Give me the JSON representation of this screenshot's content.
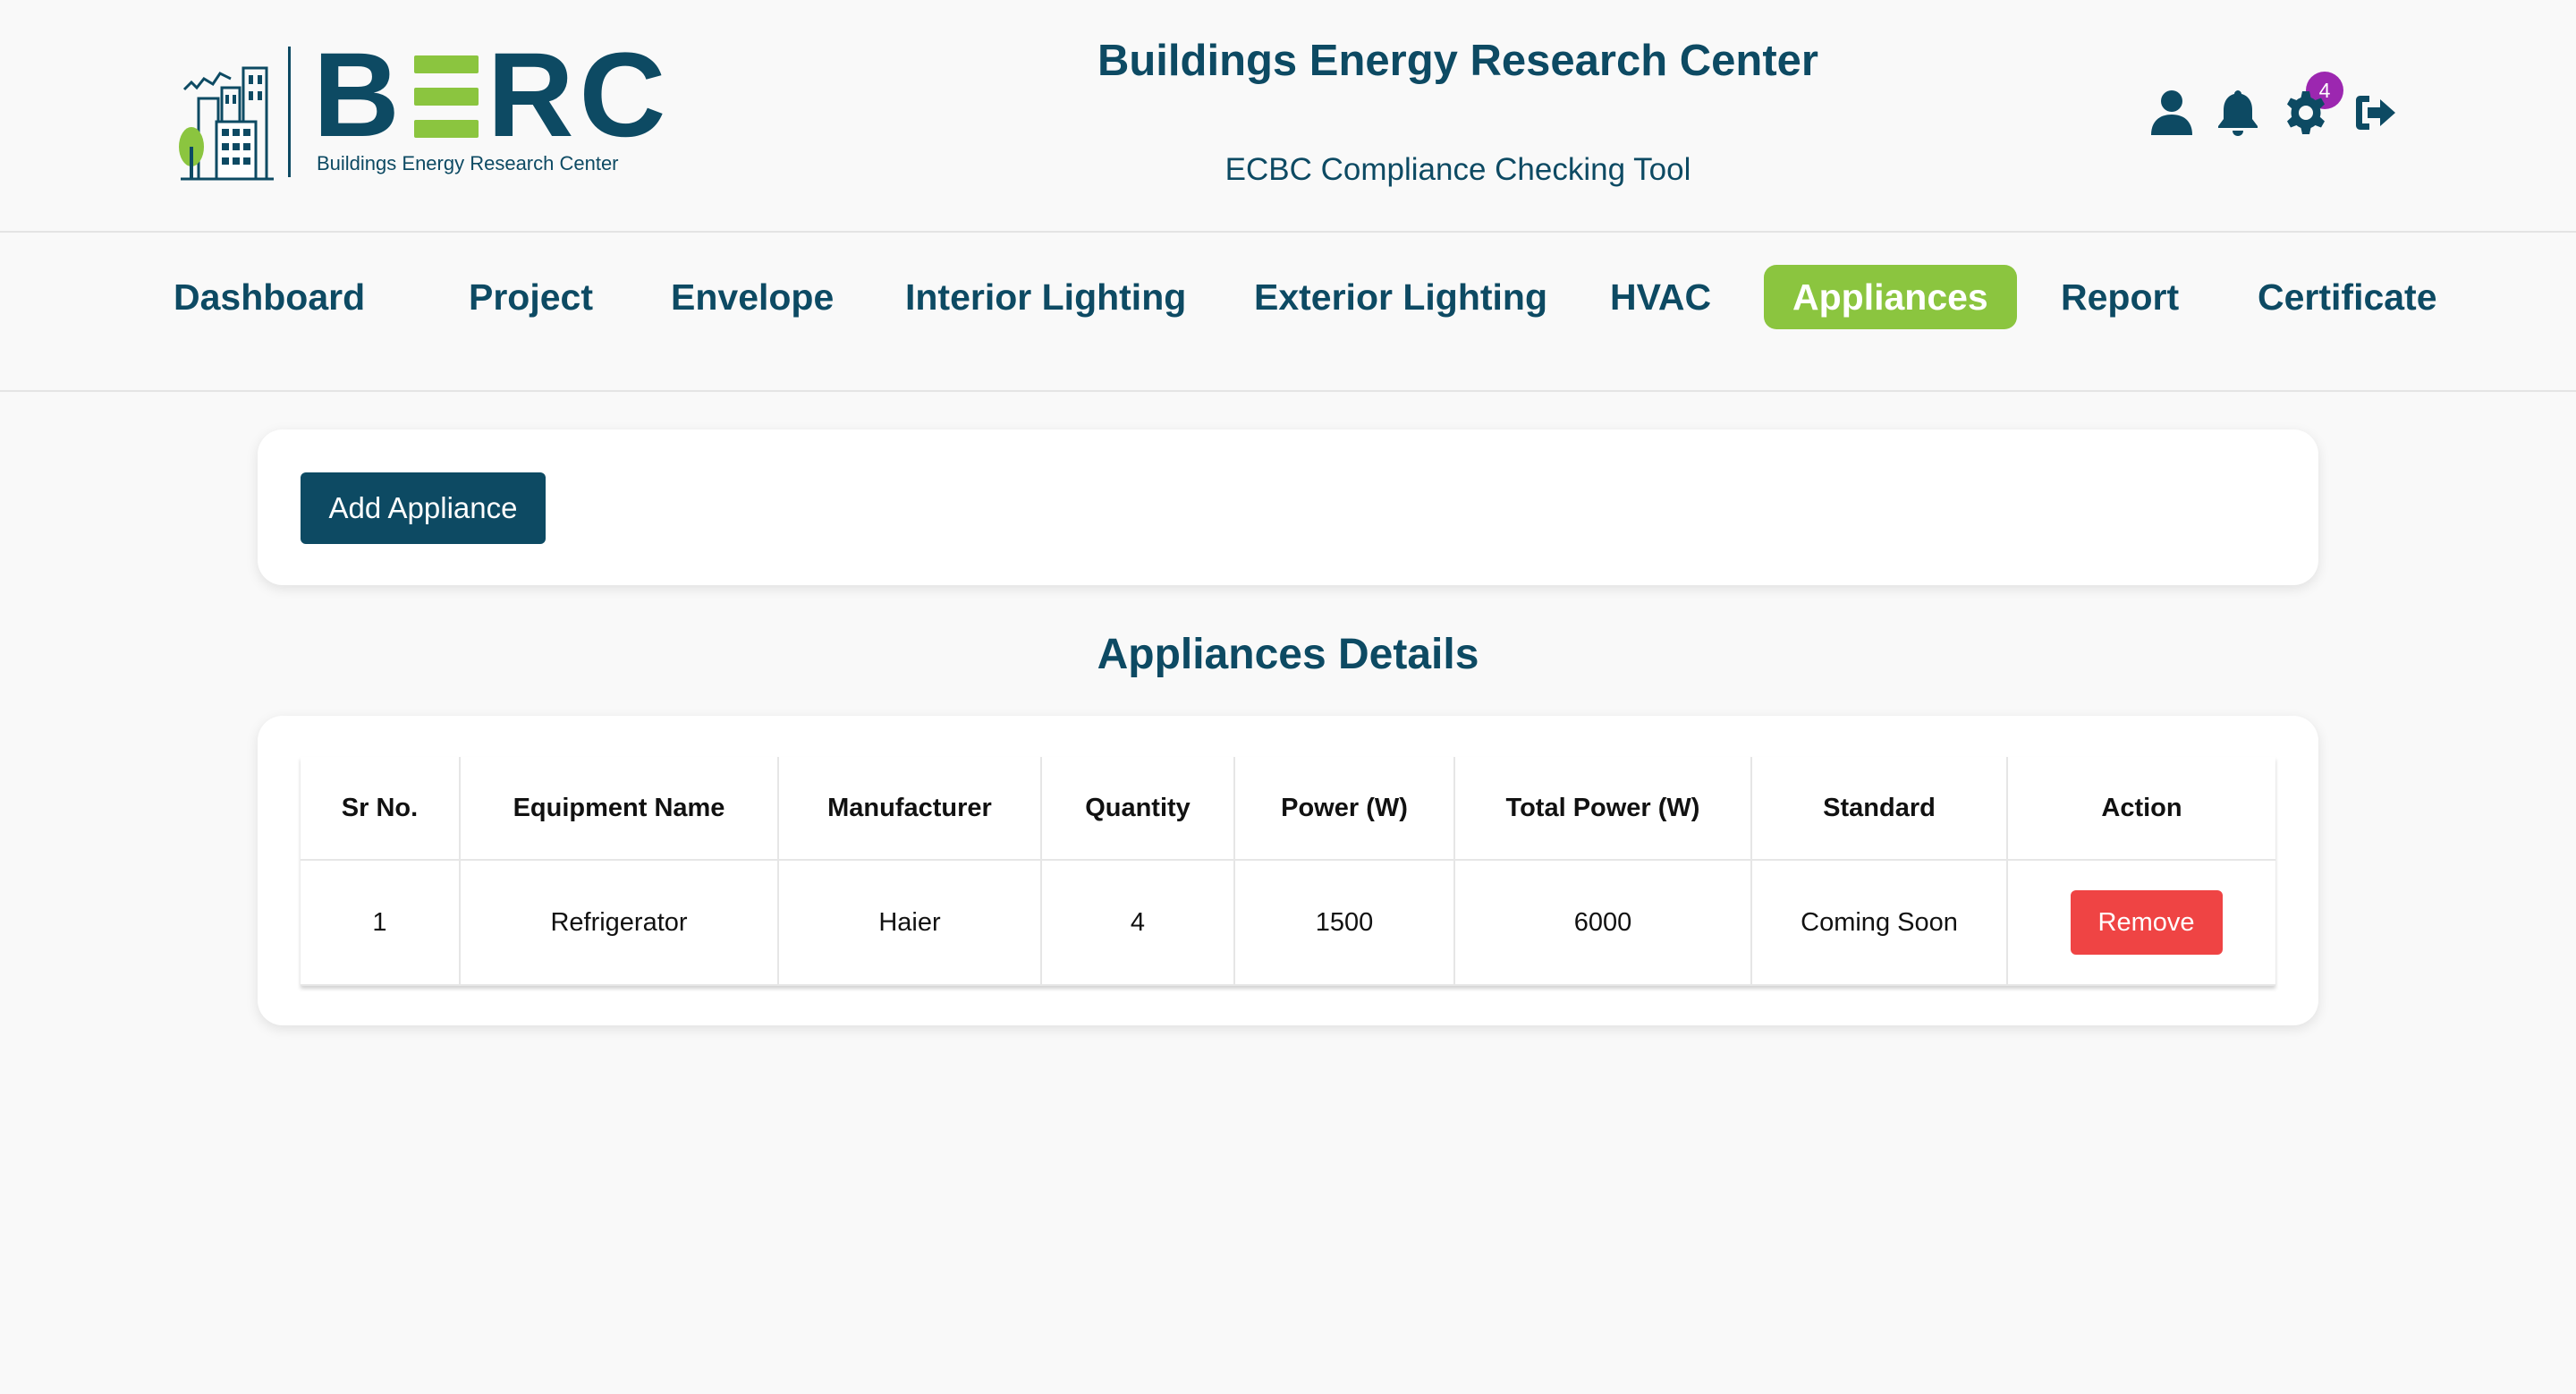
{
  "header": {
    "logo_word_left": "B",
    "logo_word_right": "RC",
    "logo_subtitle": "Buildings Energy Research Center",
    "title": "Buildings Energy Research Center",
    "subtitle": "ECBC Compliance Checking Tool",
    "icons": [
      "user-icon",
      "bell-icon",
      "gear-icon",
      "logout-icon"
    ],
    "notification_count": "4"
  },
  "nav": {
    "items": [
      {
        "label": "Dashboard"
      },
      {
        "label": "Project"
      },
      {
        "label": "Envelope"
      },
      {
        "label": "Interior Lighting"
      },
      {
        "label": "Exterior Lighting"
      },
      {
        "label": "HVAC"
      },
      {
        "label": "Appliances",
        "active": true
      },
      {
        "label": "Report"
      },
      {
        "label": "Certificate"
      }
    ]
  },
  "actions": {
    "add_label": "Add Appliance"
  },
  "section": {
    "title": "Appliances Details"
  },
  "table": {
    "columns": [
      "Sr No.",
      "Equipment Name",
      "Manufacturer",
      "Quantity",
      "Power (W)",
      "Total Power (W)",
      "Standard",
      "Action"
    ],
    "rows": [
      {
        "sr_no": "1",
        "equipment_name": "Refrigerator",
        "manufacturer": "Haier",
        "quantity": "4",
        "power": "1500",
        "total_power": "6000",
        "standard": "Coming Soon",
        "action_label": "Remove"
      }
    ]
  },
  "colors": {
    "primary": "#0d4a63",
    "accent": "#8bc53f",
    "danger": "#ef4444",
    "badge": "#9c27b0",
    "background": "#f9f9f9"
  }
}
